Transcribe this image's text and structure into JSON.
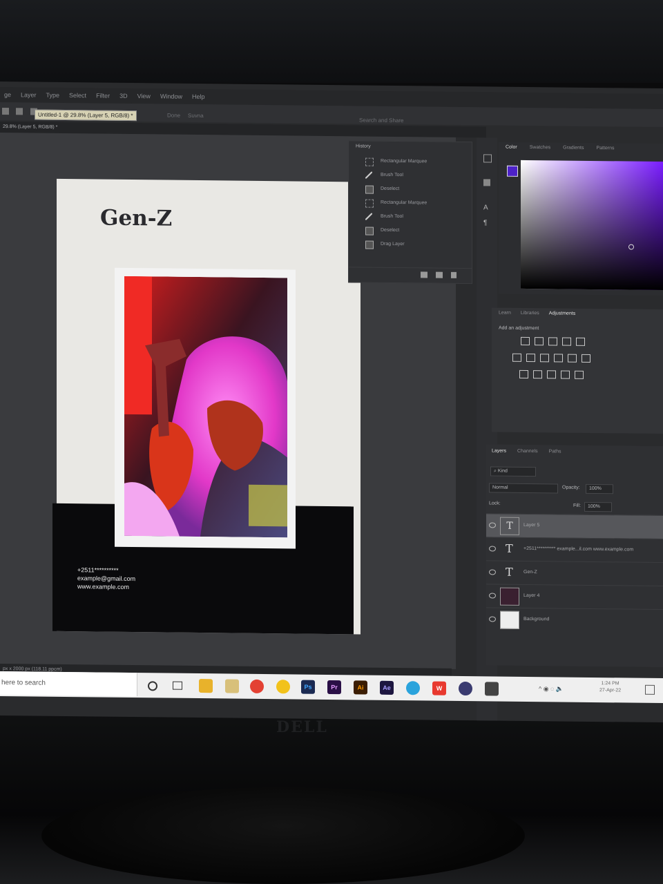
{
  "menu": [
    "ge",
    "Layer",
    "Type",
    "Select",
    "Filter",
    "3D",
    "View",
    "Window",
    "Help"
  ],
  "window": {
    "tooltip": "Untitled-1 @ 29.8% (Layer 5, RGB/8) *",
    "doc_tab": "29.8% (Layer 5, RGB/8) *",
    "search_placeholder": "Search and Share",
    "options": [
      "Done",
      "Suvna"
    ]
  },
  "document": {
    "title": "Gen-Z",
    "contact_phone": "+2511**********",
    "contact_email": "example@gmail.com",
    "contact_web": "www.example.com",
    "status": "px x 2000 px (118.11 ppcm)"
  },
  "history": {
    "title": "History",
    "items": [
      {
        "label": "Rectangular Marquee",
        "icon": "marquee-icon"
      },
      {
        "label": "Brush Tool",
        "icon": "brush-icon"
      },
      {
        "label": "Deselect",
        "icon": "document-icon"
      },
      {
        "label": "Rectangular Marquee",
        "icon": "marquee-icon"
      },
      {
        "label": "Brush Tool",
        "icon": "brush-icon"
      },
      {
        "label": "Deselect",
        "icon": "document-icon"
      },
      {
        "label": "Drag Layer",
        "icon": "document-icon"
      }
    ]
  },
  "color_panel": {
    "tabs": [
      "Color",
      "Swatches",
      "Gradients",
      "Patterns"
    ],
    "foreground": "#4d22c9",
    "hue": "#7a1dff"
  },
  "adjustments": {
    "tabs": [
      "Learn",
      "Libraries",
      "Adjustments"
    ],
    "hint": "Add an adjustment"
  },
  "layers": {
    "tabs": [
      "Layers",
      "Channels",
      "Paths"
    ],
    "kind_label": "Kind",
    "blend_mode": "Normal",
    "opacity_label": "Opacity:",
    "opacity_value": "100%",
    "lock_label": "Lock:",
    "fill_label": "Fill:",
    "fill_value": "100%",
    "items": [
      {
        "name": "Layer 5",
        "type": "text",
        "selected": true
      },
      {
        "name": "+2511********** example...il.com www.example.com",
        "type": "text",
        "selected": false
      },
      {
        "name": "Gen-Z",
        "type": "text",
        "selected": false
      },
      {
        "name": "Layer 4",
        "type": "image",
        "selected": false
      },
      {
        "name": "Background",
        "type": "background",
        "selected": false
      }
    ]
  },
  "taskbar": {
    "search_text": "here to search",
    "apps": [
      {
        "label": "",
        "icon": "file-explorer-icon",
        "color": "#e8b22b"
      },
      {
        "label": "",
        "icon": "notes-icon",
        "color": "#d8c07a"
      },
      {
        "label": "",
        "icon": "chrome-icon",
        "color": "#e34133"
      },
      {
        "label": "",
        "icon": "drive-icon",
        "color": "#f2c21b"
      },
      {
        "label": "Ps",
        "icon": "photoshop-icon",
        "color": "#1b2a52"
      },
      {
        "label": "Pr",
        "icon": "premiere-icon",
        "color": "#2a0f46"
      },
      {
        "label": "Ai",
        "icon": "illustrator-icon",
        "color": "#3b1d03"
      },
      {
        "label": "Ae",
        "icon": "after-effects-icon",
        "color": "#1d1640"
      },
      {
        "label": "",
        "icon": "telegram-icon",
        "color": "#2aa3dc"
      },
      {
        "label": "W",
        "icon": "wps-icon",
        "color": "#e8392f"
      },
      {
        "label": "",
        "icon": "app-icon",
        "color": "#3a3b70"
      },
      {
        "label": "",
        "icon": "photos-icon",
        "color": "#444"
      }
    ],
    "time": "1:24 PM",
    "date": "27-Apr-22"
  },
  "monitor": {
    "brand": "DELL"
  }
}
